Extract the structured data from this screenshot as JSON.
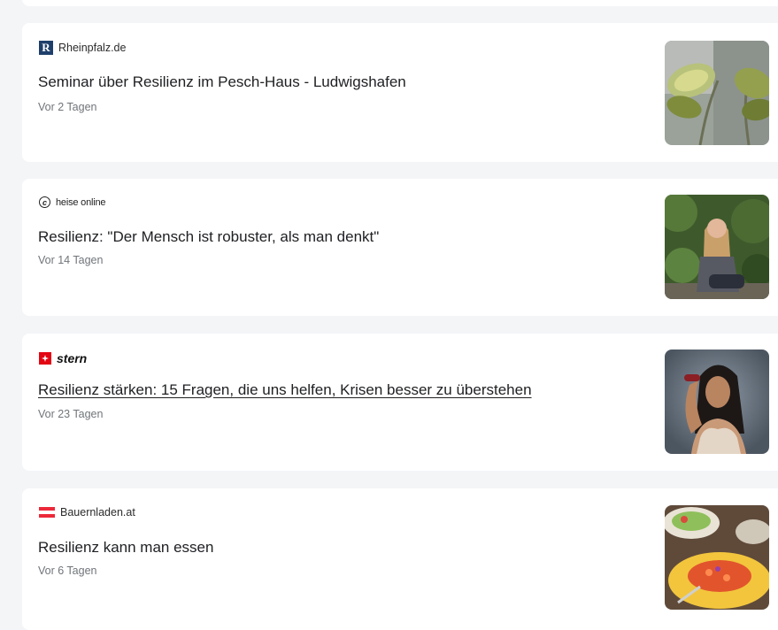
{
  "articles": [
    {
      "source": "Rheinpfalz.de",
      "logo_letter": "R",
      "headline": "Seminar über Resilienz im Pesch-Haus - Ludwigshafen",
      "time": "Vor 2 Tagen",
      "thumbnail": "plant-leaves-image"
    },
    {
      "source": "heise online",
      "headline": "Resilienz: \"Der Mensch ist robuster, als man denkt\"",
      "time": "Vor 14 Tagen",
      "thumbnail": "woman-sitting-outdoors-image"
    },
    {
      "source": "stern",
      "headline": "Resilienz stärken: 15 Fragen, die uns helfen, Krisen besser zu überstehen",
      "time": "Vor 23 Tagen",
      "thumbnail": "woman-flexing-arm-image"
    },
    {
      "source": "Bauernladen.at",
      "headline": "Resilienz kann man essen",
      "time": "Vor 6 Tagen",
      "thumbnail": "food-plate-image"
    }
  ],
  "colors": {
    "background": "#f4f5f7",
    "card": "#ffffff",
    "headline": "#202124",
    "time": "#70757a",
    "rheinpfalz_logo": "#1f3f6b",
    "stern_logo": "#e30613",
    "austria_red": "#ed2939"
  }
}
